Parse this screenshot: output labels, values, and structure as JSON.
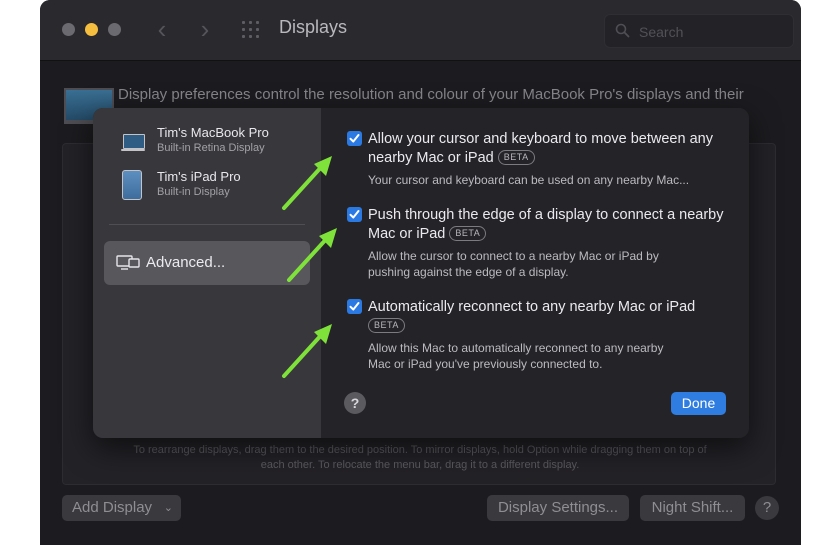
{
  "window": {
    "title": "Displays",
    "search_placeholder": "Search"
  },
  "background": {
    "description": "Display preferences control the resolution and colour of your MacBook Pro's displays and their",
    "hint": "To rearrange displays, drag them to the desired position. To mirror displays, hold Option while dragging them on top of each other. To relocate the menu bar, drag it to a different display.",
    "add_display_label": "Add Display",
    "display_settings_label": "Display Settings...",
    "night_shift_label": "Night Shift...",
    "help_label": "?"
  },
  "sheet": {
    "sidebar": {
      "items": [
        {
          "name": "Tim's MacBook Pro",
          "sub": "Built-in Retina Display"
        },
        {
          "name": "Tim's iPad Pro",
          "sub": "Built-in Display"
        }
      ],
      "advanced_label": "Advanced..."
    },
    "options": [
      {
        "title": "Allow your cursor and keyboard to move between any nearby Mac or iPad",
        "badge": "BETA",
        "desc_lines": [
          "Your cursor and keyboard can be used on any nearby Mac..."
        ],
        "checked": true
      },
      {
        "title": "Push through the edge of a display to connect a nearby Mac or iPad",
        "badge": "BETA",
        "desc_lines": [
          "Allow the cursor to connect to a nearby Mac or iPad by",
          "pushing against the edge of a display."
        ],
        "checked": true
      },
      {
        "title": "Automatically reconnect to any nearby Mac or iPad",
        "badge": "BETA",
        "desc_lines": [
          "Allow this Mac to automatically reconnect to any nearby",
          "Mac or iPad you've previously connected to."
        ],
        "checked": true
      }
    ],
    "help_label": "?",
    "done_label": "Done"
  },
  "colors": {
    "accent": "#2f7de0",
    "checkbox": "#2b7ae4",
    "annotation_arrow": "#7fe23b"
  }
}
